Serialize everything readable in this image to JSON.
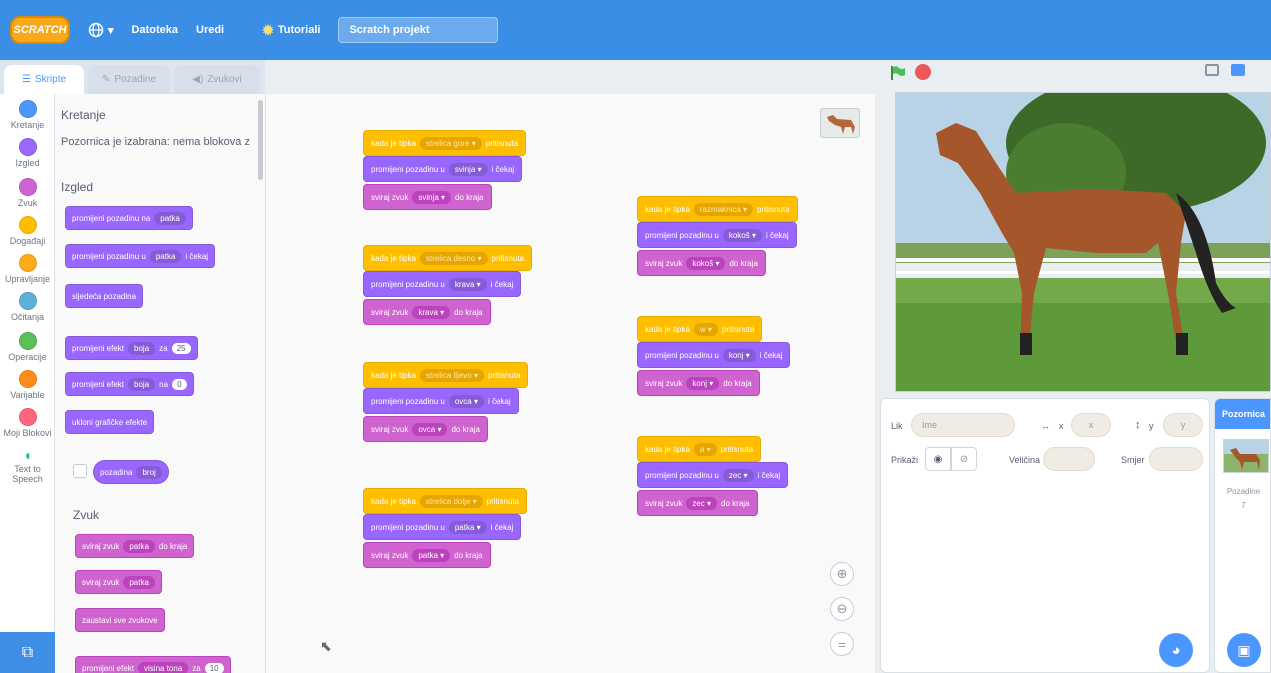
{
  "menubar": {
    "logo": "SCRATCH",
    "language_icon": "globe-icon",
    "file": "Datoteka",
    "edit": "Uredi",
    "tutorials": "Tutoriali",
    "project_title": "Scratch projekt"
  },
  "tabs": {
    "code": "Skripte",
    "backdrops": "Pozadine",
    "sounds": "Zvukovi"
  },
  "categories": [
    {
      "label": "Kretanje",
      "color": "#4c97ff"
    },
    {
      "label": "Izgled",
      "color": "#9966ff"
    },
    {
      "label": "Zvuk",
      "color": "#cf63cf"
    },
    {
      "label": "Događaji",
      "color": "#ffbf00"
    },
    {
      "label": "Upravljanje",
      "color": "#ffab19"
    },
    {
      "label": "Očitanja",
      "color": "#5cb1d6"
    },
    {
      "label": "Operacije",
      "color": "#59c059"
    },
    {
      "label": "Varijable",
      "color": "#ff8c1a"
    },
    {
      "label": "Moji Blokovi",
      "color": "#ff6680"
    },
    {
      "label": "Text to Speech",
      "color": "#0fbd8c"
    }
  ],
  "palette": {
    "motion_header": "Kretanje",
    "motion_note": "Pozornica je izabrana: nema blokova z",
    "looks_header": "Izgled",
    "b1_text": "promijeni pozadinu na",
    "b1_slot": "patka",
    "b2_text": "promijeni pozadinu u",
    "b2_slot": "patka",
    "b2_tail": "i čekaj",
    "b3_text": "sljedeća pozadina",
    "b4_text": "promijeni efekt",
    "b4_slot": "boja",
    "b4_mid": "za",
    "b4_num": "25",
    "b5_text": "promijeni efekt",
    "b5_slot": "boja",
    "b5_mid": "na",
    "b5_num": "0",
    "b6_text": "ukloni grafičke efekte",
    "b7_slot": "pozadina",
    "b7_slot2": "broj",
    "sound_header": "Zvuk",
    "s1_text": "sviraj zvuk",
    "s1_slot": "patka",
    "s1_tail": "do kraja",
    "s2_text": "sviraj zvuk",
    "s2_slot": "patka",
    "s3_text": "zaustavi sve zvukove",
    "s4_text": "promijeni efekt",
    "s4_slot": "visina tona",
    "s4_mid": "za",
    "s4_num": "10"
  },
  "scripts": [
    {
      "key": "strelica gore",
      "animal": "svinja"
    },
    {
      "key": "strelica desno",
      "animal": "krava"
    },
    {
      "key": "strelica lijevo",
      "animal": "ovca"
    },
    {
      "key": "strelica dolje",
      "animal": "patka"
    },
    {
      "key": "razmaknica",
      "animal": "kokoš"
    },
    {
      "key": "w",
      "animal": "konj"
    },
    {
      "key": "a",
      "animal": "zec"
    }
  ],
  "script_words": {
    "when": "kada je tipka",
    "pressed": "pritisnuta",
    "switch": "promijeni pozadinu u",
    "wait": "i čekaj",
    "play": "sviraj zvuk",
    "until": "do kraja"
  },
  "zoom": {
    "in": "⊕",
    "out": "⊖",
    "reset": "="
  },
  "stage_bar": {
    "flag_icon": "green-flag-icon",
    "stop_icon": "stop-icon"
  },
  "sprite_info": {
    "sprite_label": "Lik",
    "name_placeholder": "Ime",
    "x_label": "x",
    "x_value": "x",
    "y_label": "y",
    "y_value": "y",
    "show_label": "Prikaži",
    "size_label": "Veličina",
    "direction_label": "Smjer"
  },
  "stage_panel": {
    "title": "Pozornica",
    "backdrops_label": "Pozadine",
    "backdrops_count": "7"
  }
}
